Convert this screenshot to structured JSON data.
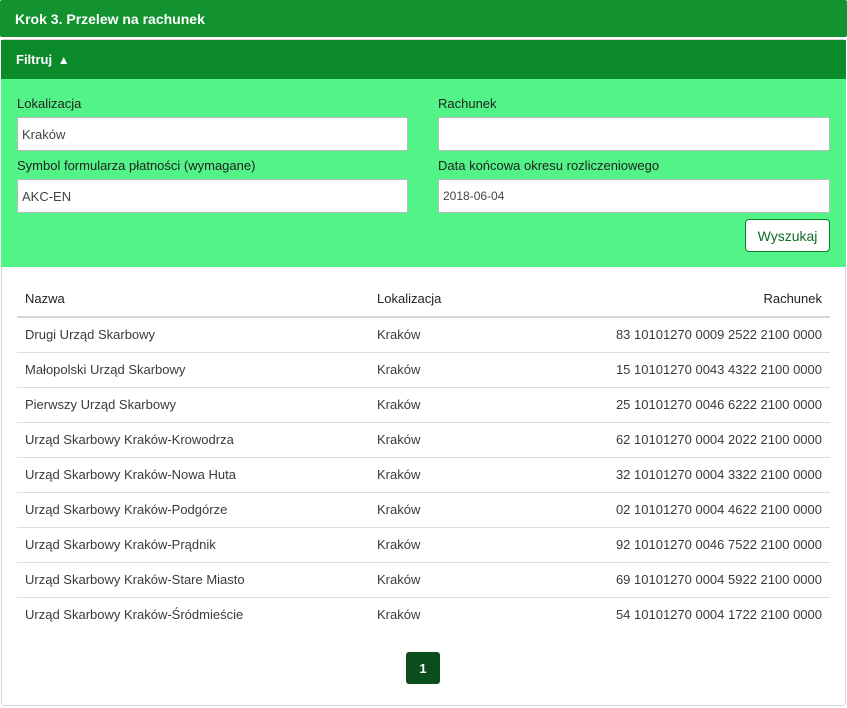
{
  "header": {
    "title": "Krok 3. Przelew na rachunek"
  },
  "filter": {
    "toggle_label": "Filtruj",
    "toggle_arrow": "▲",
    "location": {
      "label": "Lokalizacja",
      "value": "Kraków"
    },
    "account": {
      "label": "Rachunek",
      "value": ""
    },
    "symbol": {
      "label": "Symbol formularza płatności (wymagane)",
      "value": "AKC-EN"
    },
    "end_date": {
      "label": "Data końcowa okresu rozliczeniowego",
      "value": "2018-06-04"
    },
    "search_button": "Wyszukaj"
  },
  "table": {
    "columns": [
      "Nazwa",
      "Lokalizacja",
      "Rachunek"
    ],
    "rows": [
      [
        "Drugi Urząd Skarbowy",
        "Kraków",
        "83 10101270 0009 2522 2100 0000"
      ],
      [
        "Małopolski Urząd Skarbowy",
        "Kraków",
        "15 10101270 0043 4322 2100 0000"
      ],
      [
        "Pierwszy Urząd Skarbowy",
        "Kraków",
        "25 10101270 0046 6222 2100 0000"
      ],
      [
        "Urząd Skarbowy Kraków-Krowodrza",
        "Kraków",
        "62 10101270 0004 2022 2100 0000"
      ],
      [
        "Urząd Skarbowy Kraków-Nowa Huta",
        "Kraków",
        "32 10101270 0004 3322 2100 0000"
      ],
      [
        "Urząd Skarbowy Kraków-Podgórze",
        "Kraków",
        "02 10101270 0004 4622 2100 0000"
      ],
      [
        "Urząd Skarbowy Kraków-Prądnik",
        "Kraków",
        "92 10101270 0046 7522 2100 0000"
      ],
      [
        "Urząd Skarbowy Kraków-Stare Miasto",
        "Kraków",
        "69 10101270 0004 5922 2100 0000"
      ],
      [
        "Urząd Skarbowy Kraków-Śródmieście",
        "Kraków",
        "54 10101270 0004 1722 2100 0000"
      ]
    ]
  },
  "pagination": {
    "current_page": "1"
  },
  "colors": {
    "header_green": "#13932f",
    "filter_head_green": "#0b8a29",
    "filter_body_green": "#52f487",
    "page_button": "#0c4d1c"
  }
}
